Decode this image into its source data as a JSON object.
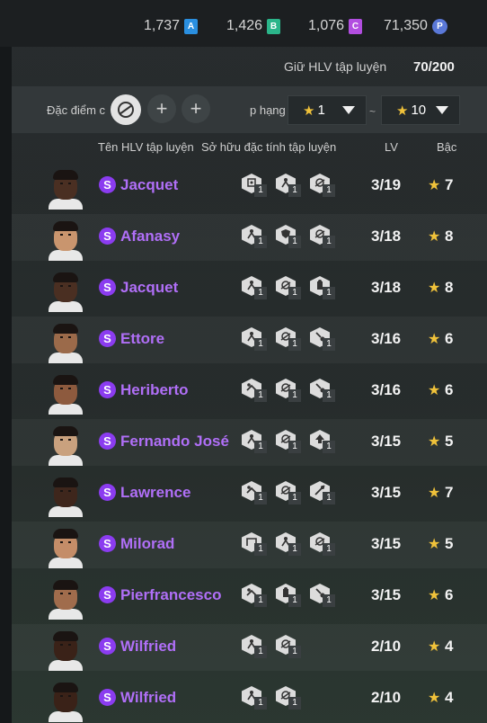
{
  "currencies": [
    {
      "value": "1,737",
      "badge": "A",
      "color": "#2a8fe0"
    },
    {
      "value": "1,426",
      "badge": "B",
      "color": "#2bb58a"
    },
    {
      "value": "1,076",
      "badge": "C",
      "color": "#b24ee0"
    },
    {
      "value": "71,350",
      "badge": "P",
      "color": "#5a78d8"
    }
  ],
  "limit": {
    "label": "Giữ HLV tập luyện",
    "value": "70/200"
  },
  "filter": {
    "trait_label": "Đặc điểm c",
    "plus": "+",
    "sort_label": "p hạng",
    "min_rank": "1",
    "max_rank": "10",
    "star": "★",
    "tilde": "~"
  },
  "headers": {
    "name": "Tên HLV tập luyện",
    "traits": "Sở hữu đặc tính tập luyện",
    "lv": "LV",
    "rank": "Bậc"
  },
  "coaches": [
    {
      "name": "Jacquet",
      "lv": "3/19",
      "rank": "7",
      "skin": "#4a2f22",
      "traits": [
        "1",
        "1",
        "1"
      ],
      "icons": [
        "coach-board-icon",
        "player-icon",
        "sprint-icon"
      ]
    },
    {
      "name": "Afanasy",
      "lv": "3/18",
      "rank": "8",
      "skin": "#c9956e",
      "traits": [
        "1",
        "1",
        "1"
      ],
      "icons": [
        "player-icon",
        "shield-icon",
        "sprint-icon"
      ]
    },
    {
      "name": "Jacquet",
      "lv": "3/18",
      "rank": "8",
      "skin": "#4a2f22",
      "traits": [
        "1",
        "1",
        "1"
      ],
      "icons": [
        "player-icon",
        "sprint-icon",
        "defender-icon"
      ]
    },
    {
      "name": "Ettore",
      "lv": "3/16",
      "rank": "6",
      "skin": "#9b6a4a",
      "traits": [
        "1",
        "1",
        "1"
      ],
      "icons": [
        "player-icon",
        "sprint-icon",
        "kick-icon"
      ]
    },
    {
      "name": "Heriberto",
      "lv": "3/16",
      "rank": "6",
      "skin": "#8d5a3e",
      "traits": [
        "1",
        "1",
        "1"
      ],
      "icons": [
        "tackle-icon",
        "sprint-icon",
        "kick-icon"
      ]
    },
    {
      "name": "Fernando José",
      "lv": "3/15",
      "rank": "5",
      "skin": "#c9a17e",
      "traits": [
        "1",
        "1",
        "1"
      ],
      "icons": [
        "player-icon",
        "sprint-icon",
        "arrow-up-icon"
      ]
    },
    {
      "name": "Lawrence",
      "lv": "3/15",
      "rank": "7",
      "skin": "#3e261c",
      "traits": [
        "1",
        "1",
        "1"
      ],
      "icons": [
        "tackle-icon",
        "sprint-icon",
        "pass-icon"
      ]
    },
    {
      "name": "Milorad",
      "lv": "3/15",
      "rank": "5",
      "skin": "#c48d68",
      "traits": [
        "1",
        "1",
        "1"
      ],
      "icons": [
        "goal-icon",
        "player-icon",
        "sprint-icon"
      ]
    },
    {
      "name": "Pierfrancesco",
      "lv": "3/15",
      "rank": "6",
      "skin": "#a06c4c",
      "traits": [
        "1",
        "1",
        "1"
      ],
      "icons": [
        "tackle-icon",
        "defender-icon",
        "kick-icon"
      ]
    },
    {
      "name": "Wilfried",
      "lv": "2/10",
      "rank": "4",
      "skin": "#3a2218",
      "traits": [
        "1",
        "1"
      ],
      "icons": [
        "player-icon",
        "sprint-icon"
      ]
    },
    {
      "name": "Wilfried",
      "lv": "2/10",
      "rank": "4",
      "skin": "#3a2218",
      "traits": [
        "1",
        "1"
      ],
      "icons": [
        "player-icon",
        "sprint-icon"
      ]
    }
  ]
}
